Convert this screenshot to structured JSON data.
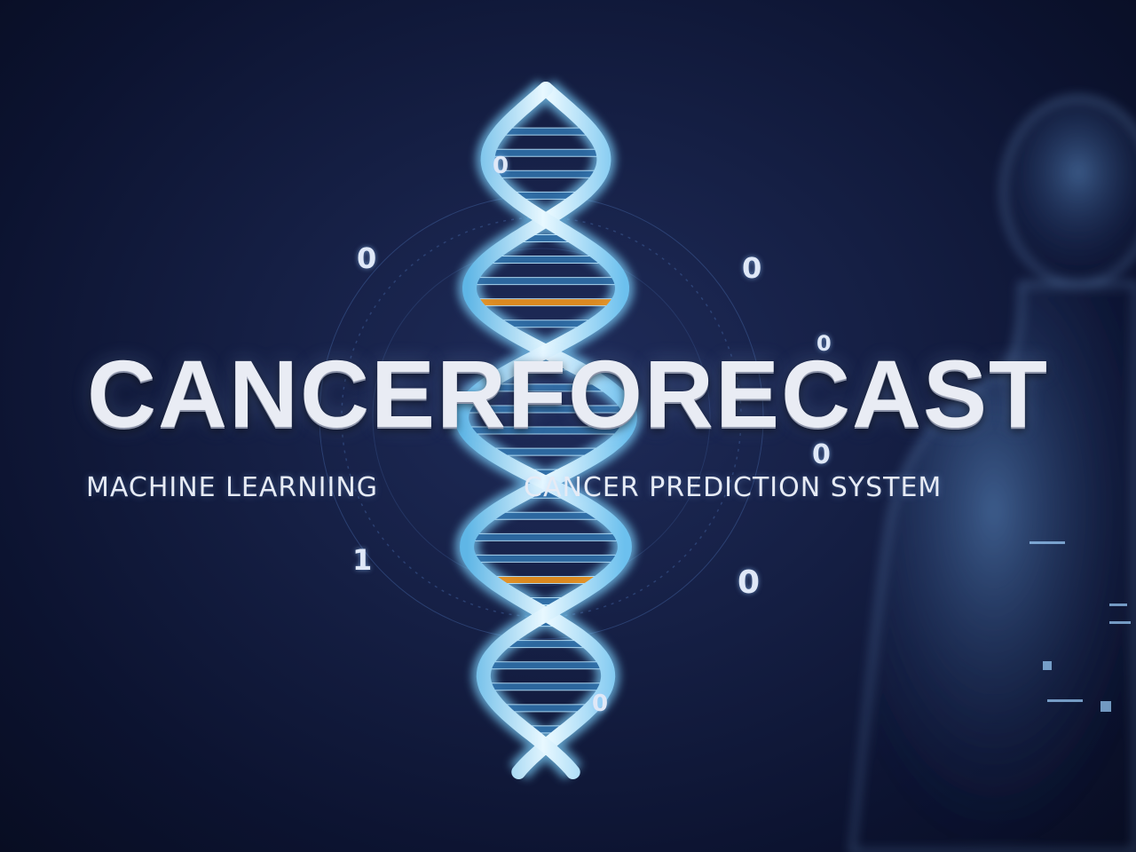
{
  "title": "CANCERFORECAST",
  "subtitle_left": "MACHINE LEARNIING",
  "subtitle_right": "CANCER  PREDICTION SYSTEM",
  "binary_digits": [
    "0",
    "0",
    "0",
    "0",
    "0",
    "1",
    "0",
    "0"
  ],
  "colors": {
    "background": "#121a3d",
    "helix_glow": "#7fd4ff",
    "title": "#e9ecf4",
    "accent_orange": "#f0941c"
  }
}
